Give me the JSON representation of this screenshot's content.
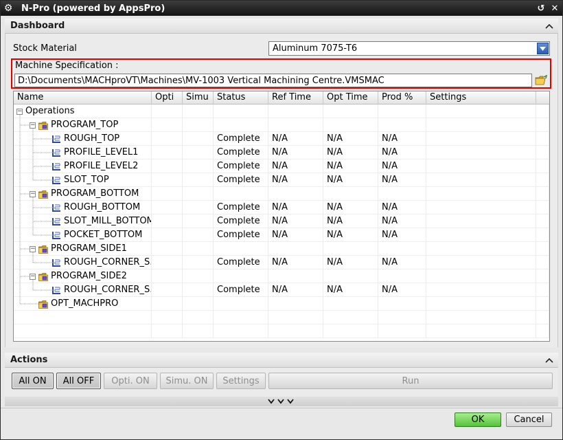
{
  "window": {
    "title": "N-Pro (powered by AppsPro)"
  },
  "dashboard": {
    "title": "Dashboard",
    "stock_label": "Stock Material",
    "stock_value": "Aluminum 7075-T6",
    "machine_label": "Machine Specification :",
    "machine_path": "D:\\Documents\\MACHproVT\\Machines\\MV-1003 Vertical Machining Centre.VMSMAC"
  },
  "table": {
    "columns": [
      "Name",
      "Opti",
      "Simu",
      "Status",
      "Ref Time",
      "Opt Time",
      "Prod %",
      "Settings"
    ],
    "rows": [
      {
        "name": "Operations",
        "status": "",
        "ref": "",
        "opt": "",
        "prod": ""
      },
      {
        "name": "PROGRAM_TOP",
        "status": "",
        "ref": "",
        "opt": "",
        "prod": ""
      },
      {
        "name": "ROUGH_TOP",
        "status": "Complete",
        "ref": "N/A",
        "opt": "N/A",
        "prod": "N/A"
      },
      {
        "name": "PROFILE_LEVEL1",
        "status": "Complete",
        "ref": "N/A",
        "opt": "N/A",
        "prod": "N/A"
      },
      {
        "name": "PROFILE_LEVEL2",
        "status": "Complete",
        "ref": "N/A",
        "opt": "N/A",
        "prod": "N/A"
      },
      {
        "name": "SLOT_TOP",
        "status": "Complete",
        "ref": "N/A",
        "opt": "N/A",
        "prod": "N/A"
      },
      {
        "name": "PROGRAM_BOTTOM",
        "status": "",
        "ref": "",
        "opt": "",
        "prod": ""
      },
      {
        "name": "ROUGH_BOTTOM",
        "status": "Complete",
        "ref": "N/A",
        "opt": "N/A",
        "prod": "N/A"
      },
      {
        "name": "SLOT_MILL_BOTTOM",
        "status": "Complete",
        "ref": "N/A",
        "opt": "N/A",
        "prod": "N/A"
      },
      {
        "name": "POCKET_BOTTOM",
        "status": "Complete",
        "ref": "N/A",
        "opt": "N/A",
        "prod": "N/A"
      },
      {
        "name": "PROGRAM_SIDE1",
        "status": "",
        "ref": "",
        "opt": "",
        "prod": ""
      },
      {
        "name": "ROUGH_CORNER_S...",
        "status": "Complete",
        "ref": "N/A",
        "opt": "N/A",
        "prod": "N/A"
      },
      {
        "name": "PROGRAM_SIDE2",
        "status": "",
        "ref": "",
        "opt": "",
        "prod": ""
      },
      {
        "name": "ROUGH_CORNER_S...",
        "status": "Complete",
        "ref": "N/A",
        "opt": "N/A",
        "prod": "N/A"
      },
      {
        "name": "OPT_MACHPRO",
        "status": "",
        "ref": "",
        "opt": "",
        "prod": ""
      }
    ]
  },
  "actions": {
    "title": "Actions",
    "all_on": "All ON",
    "all_off": "All OFF",
    "opti_on": "Opti. ON",
    "simu_on": "Simu. ON",
    "settings": "Settings",
    "run": "Run"
  },
  "footer": {
    "ok": "OK",
    "cancel": "Cancel"
  },
  "colors": {
    "highlight_border": "#e00000",
    "ok_green": "#53c338"
  }
}
